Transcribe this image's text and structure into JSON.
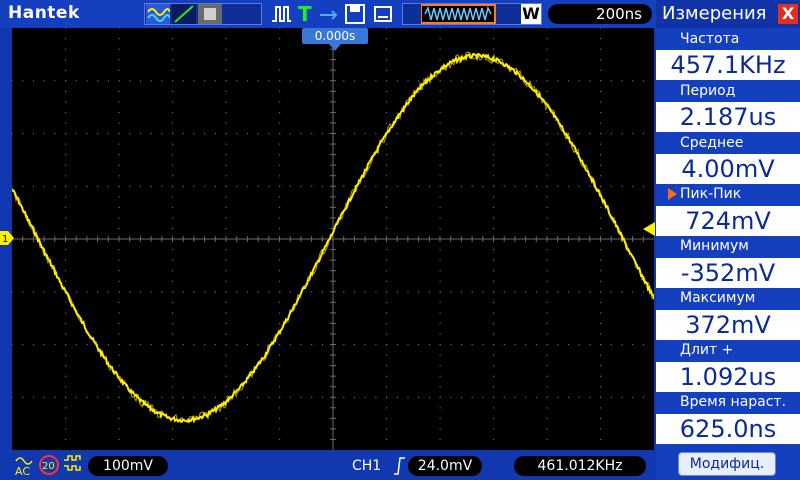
{
  "toolbar": {
    "brand": "Hantek",
    "timebase": "200ns",
    "waveform_mode": "W",
    "icons": [
      "waveform-icon",
      "trigger-slope-icon",
      "memory-icon",
      "pulse-icon",
      "trigger-T-icon",
      "save-icon",
      "usb-icon",
      "record-preview-icon"
    ]
  },
  "screen": {
    "trigger_time": "0.000s",
    "channel_marker": "1",
    "colors": {
      "trace": "#ffee00",
      "grid": "#6a6a6a",
      "background": "#000000"
    }
  },
  "measure": {
    "title": "Измерения",
    "close": "X",
    "items": [
      {
        "label": "Частота",
        "value": "457.1KHz"
      },
      {
        "label": "Период",
        "value": "2.187us"
      },
      {
        "label": "Среднее",
        "value": "4.00mV"
      },
      {
        "label": "Пик-Пик",
        "value": "724mV"
      },
      {
        "label": "Минимум",
        "value": "-352mV"
      },
      {
        "label": "Максимум",
        "value": "372mV"
      },
      {
        "label": "Длит  +",
        "value": "1.092us"
      },
      {
        "label": "Время  нараст.",
        "value": "625.0ns"
      }
    ],
    "modify": "Модифиц."
  },
  "bottombar": {
    "coupling": "AC",
    "bw_limit": "20",
    "volts_div": "100mV",
    "channel": "CH1",
    "trigger_level": "24.0mV",
    "trigger_freq": "461.012KHz"
  }
}
